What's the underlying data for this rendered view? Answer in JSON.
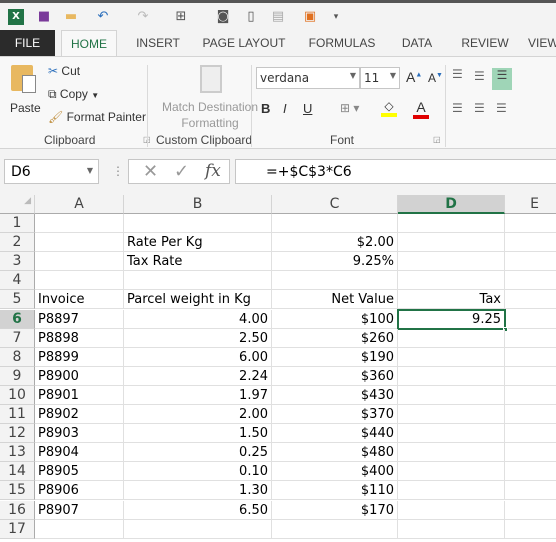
{
  "window": {
    "app_icon": "excel-icon"
  },
  "qat": [
    {
      "icon": "excel-icon"
    },
    {
      "icon": "save-icon"
    },
    {
      "icon": "folder-icon"
    },
    {
      "icon": "undo-icon"
    },
    {
      "icon": "redo-icon"
    },
    {
      "icon": "layout-icon"
    },
    {
      "icon": "camera-icon"
    },
    {
      "icon": "new-document-icon"
    },
    {
      "icon": "clipboard-icon"
    },
    {
      "icon": "paste-special-icon"
    },
    {
      "icon": "customize-icon"
    }
  ],
  "tabs": [
    "FILE",
    "HOME",
    "INSERT",
    "PAGE LAYOUT",
    "FORMULAS",
    "DATA",
    "REVIEW",
    "VIEW"
  ],
  "ribbon": {
    "clipboard": {
      "paste": "Paste",
      "cut": "Cut",
      "copy": "Copy",
      "format_painter": "Format Painter",
      "label": "Clipboard"
    },
    "custom_clipboard": {
      "match": "Match Destination",
      "formatting": "Formatting",
      "label": "Custom Clipboard"
    },
    "font": {
      "name": "verdana",
      "size": "11",
      "bold": "B",
      "italic": "I",
      "underline": "U",
      "label": "Font",
      "highlight_color": "#ffff00",
      "font_color": "#e00000"
    }
  },
  "formula_bar": {
    "name_box": "D6",
    "fx": "fx",
    "formula": "=+$C$3*C6"
  },
  "columns": [
    "A",
    "B",
    "C",
    "D",
    "E"
  ],
  "selected_cell": "D6",
  "rows": [
    {
      "n": "1",
      "a": "",
      "b": "",
      "c": "",
      "d": ""
    },
    {
      "n": "2",
      "a": "",
      "b": "Rate Per Kg",
      "c": "$2.00",
      "d": ""
    },
    {
      "n": "3",
      "a": "",
      "b": "Tax Rate",
      "c": "9.25%",
      "d": ""
    },
    {
      "n": "4",
      "a": "",
      "b": "",
      "c": "",
      "d": ""
    },
    {
      "n": "5",
      "a": "Invoice",
      "b": "Parcel weight in Kg",
      "c": "Net Value",
      "d": "Tax"
    },
    {
      "n": "6",
      "a": "P8897",
      "b": "4.00",
      "c": "$100",
      "d": "9.25"
    },
    {
      "n": "7",
      "a": "P8898",
      "b": "2.50",
      "c": "$260",
      "d": ""
    },
    {
      "n": "8",
      "a": "P8899",
      "b": "6.00",
      "c": "$190",
      "d": ""
    },
    {
      "n": "9",
      "a": "P8900",
      "b": "2.24",
      "c": "$360",
      "d": ""
    },
    {
      "n": "10",
      "a": "P8901",
      "b": "1.97",
      "c": "$430",
      "d": ""
    },
    {
      "n": "11",
      "a": "P8902",
      "b": "2.00",
      "c": "$370",
      "d": ""
    },
    {
      "n": "12",
      "a": "P8903",
      "b": "1.50",
      "c": "$440",
      "d": ""
    },
    {
      "n": "13",
      "a": "P8904",
      "b": "0.25",
      "c": "$480",
      "d": ""
    },
    {
      "n": "14",
      "a": "P8905",
      "b": "0.10",
      "c": "$400",
      "d": ""
    },
    {
      "n": "15",
      "a": "P8906",
      "b": "1.30",
      "c": "$110",
      "d": ""
    },
    {
      "n": "16",
      "a": "P8907",
      "b": "6.50",
      "c": "$170",
      "d": ""
    },
    {
      "n": "17",
      "a": "",
      "b": "",
      "c": "",
      "d": ""
    }
  ]
}
